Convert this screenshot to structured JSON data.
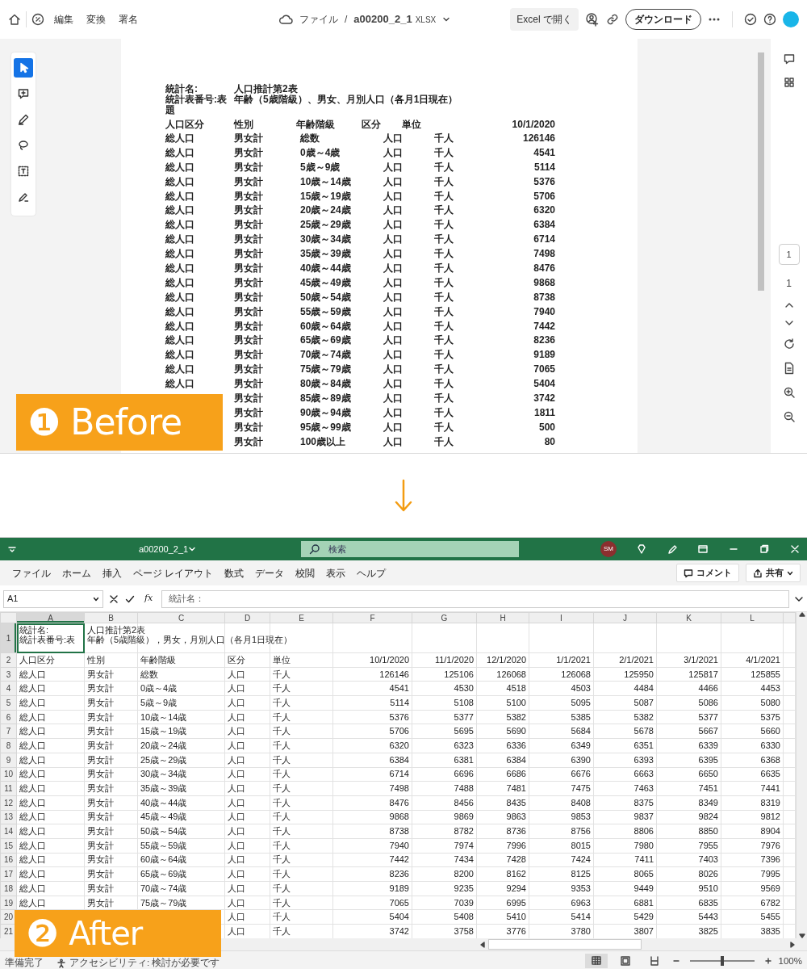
{
  "before": {
    "toolbar": {
      "menu": [
        "編集",
        "変換",
        "署名"
      ],
      "location": "ファイル",
      "separator": "/",
      "file_name": "a00200_2_1",
      "file_type": "XLSX",
      "open_button": "Excel で開く",
      "download_button": "ダウンロード"
    },
    "tools": [
      {
        "selected": true
      },
      {
        "selected": false
      },
      {
        "selected": false
      },
      {
        "selected": false
      },
      {
        "selected": false
      },
      {
        "selected": false
      }
    ],
    "page": {
      "titles": [
        {
          "label": "統計名:",
          "value": "人口推計第2表"
        },
        {
          "label": "統計表番号:表題",
          "value": "年齢（5歳階級）、男女、月別人口（各月1日現在）"
        }
      ],
      "header": [
        "人口区分",
        "性別",
        "年齢階級",
        "区分",
        "単位",
        "10/1/2020"
      ],
      "rows": [
        {
          "area": "総人口",
          "sex": "男女計",
          "age": "総数",
          "kind": "人口",
          "unit": "千人",
          "value": "126146"
        },
        {
          "area": "総人口",
          "sex": "男女計",
          "age": "0歳～4歳",
          "kind": "人口",
          "unit": "千人",
          "value": "4541"
        },
        {
          "area": "総人口",
          "sex": "男女計",
          "age": "5歳～9歳",
          "kind": "人口",
          "unit": "千人",
          "value": "5114"
        },
        {
          "area": "総人口",
          "sex": "男女計",
          "age": "10歳～14歳",
          "kind": "人口",
          "unit": "千人",
          "value": "5376"
        },
        {
          "area": "総人口",
          "sex": "男女計",
          "age": "15歳～19歳",
          "kind": "人口",
          "unit": "千人",
          "value": "5706"
        },
        {
          "area": "総人口",
          "sex": "男女計",
          "age": "20歳～24歳",
          "kind": "人口",
          "unit": "千人",
          "value": "6320"
        },
        {
          "area": "総人口",
          "sex": "男女計",
          "age": "25歳～29歳",
          "kind": "人口",
          "unit": "千人",
          "value": "6384"
        },
        {
          "area": "総人口",
          "sex": "男女計",
          "age": "30歳～34歳",
          "kind": "人口",
          "unit": "千人",
          "value": "6714"
        },
        {
          "area": "総人口",
          "sex": "男女計",
          "age": "35歳～39歳",
          "kind": "人口",
          "unit": "千人",
          "value": "7498"
        },
        {
          "area": "総人口",
          "sex": "男女計",
          "age": "40歳～44歳",
          "kind": "人口",
          "unit": "千人",
          "value": "8476"
        },
        {
          "area": "総人口",
          "sex": "男女計",
          "age": "45歳～49歳",
          "kind": "人口",
          "unit": "千人",
          "value": "9868"
        },
        {
          "area": "総人口",
          "sex": "男女計",
          "age": "50歳～54歳",
          "kind": "人口",
          "unit": "千人",
          "value": "8738"
        },
        {
          "area": "総人口",
          "sex": "男女計",
          "age": "55歳～59歳",
          "kind": "人口",
          "unit": "千人",
          "value": "7940"
        },
        {
          "area": "総人口",
          "sex": "男女計",
          "age": "60歳～64歳",
          "kind": "人口",
          "unit": "千人",
          "value": "7442"
        },
        {
          "area": "総人口",
          "sex": "男女計",
          "age": "65歳～69歳",
          "kind": "人口",
          "unit": "千人",
          "value": "8236"
        },
        {
          "area": "総人口",
          "sex": "男女計",
          "age": "70歳～74歳",
          "kind": "人口",
          "unit": "千人",
          "value": "9189"
        },
        {
          "area": "総人口",
          "sex": "男女計",
          "age": "75歳～79歳",
          "kind": "人口",
          "unit": "千人",
          "value": "7065"
        },
        {
          "area": "総人口",
          "sex": "男女計",
          "age": "80歳～84歳",
          "kind": "人口",
          "unit": "千人",
          "value": "5404"
        },
        {
          "sex": "男女計",
          "age": "85歳～89歳",
          "kind": "人口",
          "unit": "千人",
          "value": "3742"
        },
        {
          "sex": "男女計",
          "age": "90歳～94歳",
          "kind": "人口",
          "unit": "千人",
          "value": "1811"
        },
        {
          "sex": "男女計",
          "age": "95歳～99歳",
          "kind": "人口",
          "unit": "千人",
          "value": "500"
        },
        {
          "sex": "男女計",
          "age": "100歳以上",
          "kind": "人口",
          "unit": "千人",
          "value": "80"
        }
      ]
    },
    "pager": {
      "current": "1",
      "total": "1"
    }
  },
  "excel": {
    "title_bar": {
      "file_name": "a00200_2_1",
      "search_placeholder": "検索",
      "avatar": "SM"
    },
    "menu": [
      "ファイル",
      "ホーム",
      "挿入",
      "ページ レイアウト",
      "数式",
      "データ",
      "校閲",
      "表示",
      "ヘルプ"
    ],
    "comment_button": "コメント",
    "share_button": "共有",
    "name_box": "A1",
    "function_label": "fx",
    "formula": "統計名：",
    "columns": [
      "A",
      "B",
      "C",
      "D",
      "E",
      "F",
      "G",
      "H",
      "I",
      "J",
      "K",
      "L"
    ],
    "rows": [
      {
        "row": "1",
        "A": [
          "統計名:",
          "統計表番号:表"
        ],
        "B": [
          "人口推計第2表",
          "年齢（5歳階級），男女，月別人口（各月1日現在）"
        ]
      },
      {
        "row": "2",
        "A": "人口区分",
        "B": "性別",
        "C": "年齢階級",
        "D": "区分",
        "E": "単位",
        "F": "10/1/2020",
        "G": "11/1/2020",
        "H": "12/1/2020",
        "I": "1/1/2021",
        "J": "2/1/2021",
        "K": "3/1/2021",
        "L": "4/1/2021"
      },
      {
        "row": "3",
        "A": "総人口",
        "B": "男女計",
        "C": "総数",
        "D": "人口",
        "E": "千人",
        "F": "126146",
        "G": "125106",
        "H": "126068",
        "I": "126068",
        "J": "125950",
        "K": "125817",
        "L": "125855"
      },
      {
        "row": "4",
        "A": "総人口",
        "B": "男女計",
        "C": "0歳～4歳",
        "D": "人口",
        "E": "千人",
        "F": "4541",
        "G": "4530",
        "H": "4518",
        "I": "4503",
        "J": "4484",
        "K": "4466",
        "L": "4453"
      },
      {
        "row": "5",
        "A": "総人口",
        "B": "男女計",
        "C": "5歳～9歳",
        "D": "人口",
        "E": "千人",
        "F": "5114",
        "G": "5108",
        "H": "5100",
        "I": "5095",
        "J": "5087",
        "K": "5086",
        "L": "5080"
      },
      {
        "row": "6",
        "A": "総人口",
        "B": "男女計",
        "C": "10歳～14歳",
        "D": "人口",
        "E": "千人",
        "F": "5376",
        "G": "5377",
        "H": "5382",
        "I": "5385",
        "J": "5382",
        "K": "5377",
        "L": "5375"
      },
      {
        "row": "7",
        "A": "総人口",
        "B": "男女計",
        "C": "15歳～19歳",
        "D": "人口",
        "E": "千人",
        "F": "5706",
        "G": "5695",
        "H": "5690",
        "I": "5684",
        "J": "5678",
        "K": "5667",
        "L": "5660"
      },
      {
        "row": "8",
        "A": "総人口",
        "B": "男女計",
        "C": "20歳～24歳",
        "D": "人口",
        "E": "千人",
        "F": "6320",
        "G": "6323",
        "H": "6336",
        "I": "6349",
        "J": "6351",
        "K": "6339",
        "L": "6330"
      },
      {
        "row": "9",
        "A": "総人口",
        "B": "男女計",
        "C": "25歳～29歳",
        "D": "人口",
        "E": "千人",
        "F": "6384",
        "G": "6381",
        "H": "6384",
        "I": "6390",
        "J": "6393",
        "K": "6395",
        "L": "6368"
      },
      {
        "row": "10",
        "A": "総人口",
        "B": "男女計",
        "C": "30歳～34歳",
        "D": "人口",
        "E": "千人",
        "F": "6714",
        "G": "6696",
        "H": "6686",
        "I": "6676",
        "J": "6663",
        "K": "6650",
        "L": "6635"
      },
      {
        "row": "11",
        "A": "総人口",
        "B": "男女計",
        "C": "35歳～39歳",
        "D": "人口",
        "E": "千人",
        "F": "7498",
        "G": "7488",
        "H": "7481",
        "I": "7475",
        "J": "7463",
        "K": "7451",
        "L": "7441"
      },
      {
        "row": "12",
        "A": "総人口",
        "B": "男女計",
        "C": "40歳～44歳",
        "D": "人口",
        "E": "千人",
        "F": "8476",
        "G": "8456",
        "H": "8435",
        "I": "8408",
        "J": "8375",
        "K": "8349",
        "L": "8319"
      },
      {
        "row": "13",
        "A": "総人口",
        "B": "男女計",
        "C": "45歳～49歳",
        "D": "人口",
        "E": "千人",
        "F": "9868",
        "G": "9869",
        "H": "9863",
        "I": "9853",
        "J": "9837",
        "K": "9824",
        "L": "9812"
      },
      {
        "row": "14",
        "A": "総人口",
        "B": "男女計",
        "C": "50歳～54歳",
        "D": "人口",
        "E": "千人",
        "F": "8738",
        "G": "8782",
        "H": "8736",
        "I": "8756",
        "J": "8806",
        "K": "8850",
        "L": "8904"
      },
      {
        "row": "15",
        "A": "総人口",
        "B": "男女計",
        "C": "55歳～59歳",
        "D": "人口",
        "E": "千人",
        "F": "7940",
        "G": "7974",
        "H": "7996",
        "I": "8015",
        "J": "7980",
        "K": "7955",
        "L": "7976"
      },
      {
        "row": "16",
        "A": "総人口",
        "B": "男女計",
        "C": "60歳～64歳",
        "D": "人口",
        "E": "千人",
        "F": "7442",
        "G": "7434",
        "H": "7428",
        "I": "7424",
        "J": "7411",
        "K": "7403",
        "L": "7396"
      },
      {
        "row": "17",
        "A": "総人口",
        "B": "男女計",
        "C": "65歳～69歳",
        "D": "人口",
        "E": "千人",
        "F": "8236",
        "G": "8200",
        "H": "8162",
        "I": "8125",
        "J": "8065",
        "K": "8026",
        "L": "7995"
      },
      {
        "row": "18",
        "A": "総人口",
        "B": "男女計",
        "C": "70歳～74歳",
        "D": "人口",
        "E": "千人",
        "F": "9189",
        "G": "9235",
        "H": "9294",
        "I": "9353",
        "J": "9449",
        "K": "9510",
        "L": "9569"
      },
      {
        "row": "19",
        "A": "総人口",
        "B": "男女計",
        "C": "75歳～79歳",
        "D": "人口",
        "E": "千人",
        "F": "7065",
        "G": "7039",
        "H": "6995",
        "I": "6963",
        "J": "6881",
        "K": "6835",
        "L": "6782"
      },
      {
        "row": "20",
        "D": "人口",
        "E": "千人",
        "F": "5404",
        "G": "5408",
        "H": "5410",
        "I": "5414",
        "J": "5429",
        "K": "5443",
        "L": "5455"
      },
      {
        "row": "21",
        "D": "人口",
        "E": "千人",
        "F": "3742",
        "G": "3758",
        "H": "3776",
        "I": "3780",
        "J": "3807",
        "K": "3825",
        "L": "3835"
      }
    ],
    "status": {
      "ready": "準備完了",
      "accessibility": "アクセシビリティ: 検討が必要です",
      "zoom": {
        "level": 0.5,
        "label": "100%"
      }
    }
  },
  "labels": [
    {
      "number": "❶",
      "text": "Before"
    },
    {
      "number": "❷",
      "text": "After"
    }
  ]
}
